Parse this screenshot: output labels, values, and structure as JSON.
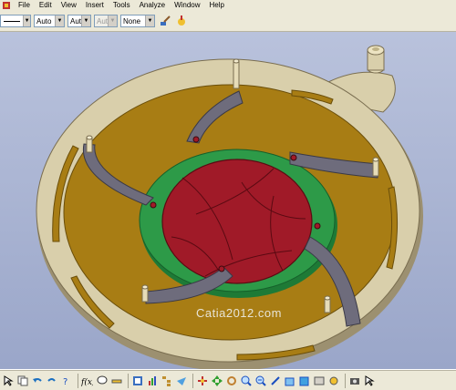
{
  "menu": {
    "items": [
      "File",
      "Edit",
      "View",
      "Insert",
      "Tools",
      "Analyze",
      "Window",
      "Help"
    ]
  },
  "toolbar": {
    "combo_auto_1": "Auto",
    "combo_auto_2": "Aut",
    "combo_auto_3": "Aut",
    "combo_none": "None"
  },
  "viewport": {
    "watermark": "Catia2012.com"
  },
  "colors": {
    "plate": "#d9cfab",
    "plate_edge": "#9c9070",
    "inner_disc": "#a87d14",
    "green_ring": "#2d9a48",
    "red_iris": "#a01a28",
    "arm": "#6e6c7c"
  },
  "bottom_icons": [
    "select-icon",
    "copy-icon",
    "undo-icon",
    "redo-icon",
    "help-icon",
    "fx-icon",
    "comment-icon",
    "measure-icon",
    "catalog-icon",
    "analysis-icon",
    "tree-icon",
    "fly-icon",
    "fit-all-icon",
    "pan-icon",
    "rotate-icon",
    "zoom-in-icon",
    "zoom-out-icon",
    "normal-view-icon",
    "views-icon",
    "shading-icon",
    "hide-show-icon",
    "swap-icon",
    "capture-icon",
    "pointer-icon"
  ]
}
